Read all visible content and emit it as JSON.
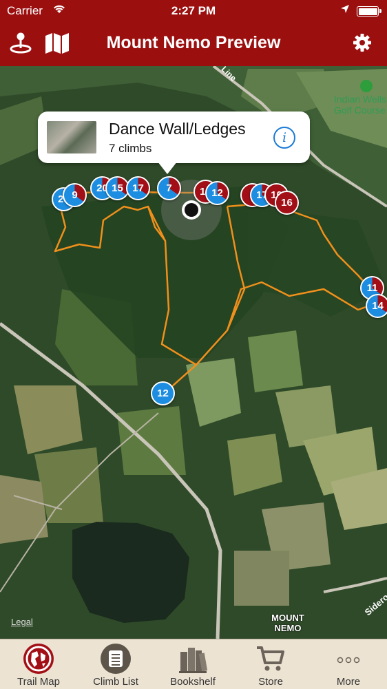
{
  "status": {
    "carrier": "Carrier",
    "time": "2:27 PM"
  },
  "header": {
    "title": "Mount Nemo Preview"
  },
  "callout": {
    "title": "Dance Wall/Ledges",
    "subtitle": "7 climbs",
    "info": "i"
  },
  "map": {
    "legal": "Legal",
    "labels": {
      "golf": "Indian Wells Golf Course",
      "road_top": "Line",
      "road_right": "Sideroad",
      "place": "MOUNT NEMO"
    },
    "markers": [
      "23",
      "9",
      "20",
      "15",
      "17",
      "7",
      "16",
      "12",
      "1",
      "17",
      "10",
      "16",
      "11",
      "14",
      "12"
    ]
  },
  "tabs": [
    {
      "label": "Trail Map",
      "icon": "globe-icon",
      "active": true
    },
    {
      "label": "Climb List",
      "icon": "list-icon",
      "active": false
    },
    {
      "label": "Bookshelf",
      "icon": "books-icon",
      "active": false
    },
    {
      "label": "Store",
      "icon": "cart-icon",
      "active": false
    },
    {
      "label": "More",
      "icon": "more-icon",
      "active": false
    }
  ],
  "colors": {
    "brand": "#9b0f0f",
    "marker_red": "#a30f16",
    "marker_blue": "#1c8de0",
    "trail": "#f0901c"
  }
}
